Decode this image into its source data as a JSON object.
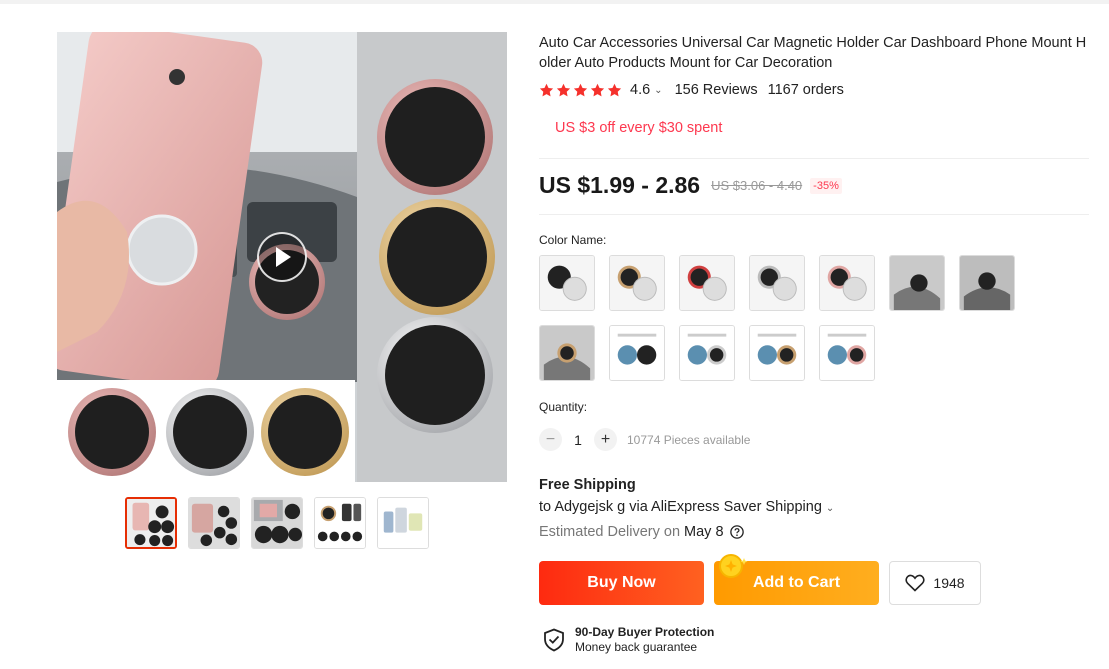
{
  "product": {
    "title": "Auto Car Accessories Universal Car Magnetic Holder Car Dashboard Phone Mount Holder Auto Products Mount for Car Decoration",
    "rating": "4.6",
    "reviews": "156 Reviews",
    "orders": "1167 orders",
    "promo": "US $3 off every $30 spent",
    "price": "US $1.99 - 2.86",
    "original_price": "US $3.06 - 4.40",
    "discount": "-35%"
  },
  "gallery": {
    "main_image": "magnetic-phone-mount-photo",
    "play_icon": "play-icon",
    "thumbnail_count": 5,
    "active_thumbnail": 1
  },
  "options": {
    "color_label": "Color Name:",
    "color_count": 12
  },
  "quantity": {
    "label": "Quantity:",
    "value": "1",
    "minus": "−",
    "plus": "+",
    "available": "10774 Pieces available"
  },
  "shipping": {
    "title": "Free Shipping",
    "to": "to Adygejsk g via AliExpress Saver Shipping",
    "delivery_prefix": "Estimated Delivery on",
    "delivery_date": "May 8"
  },
  "actions": {
    "buy_now": "Buy Now",
    "add_to_cart": "Add to Cart",
    "wishlist_count": "1948"
  },
  "protection": {
    "title": "90-Day Buyer Protection",
    "subtitle": "Money back guarantee"
  },
  "colors": {
    "accent_red": "#fd384f",
    "buy_now": "#fe2a10",
    "add_to_cart": "#ff9a00"
  }
}
